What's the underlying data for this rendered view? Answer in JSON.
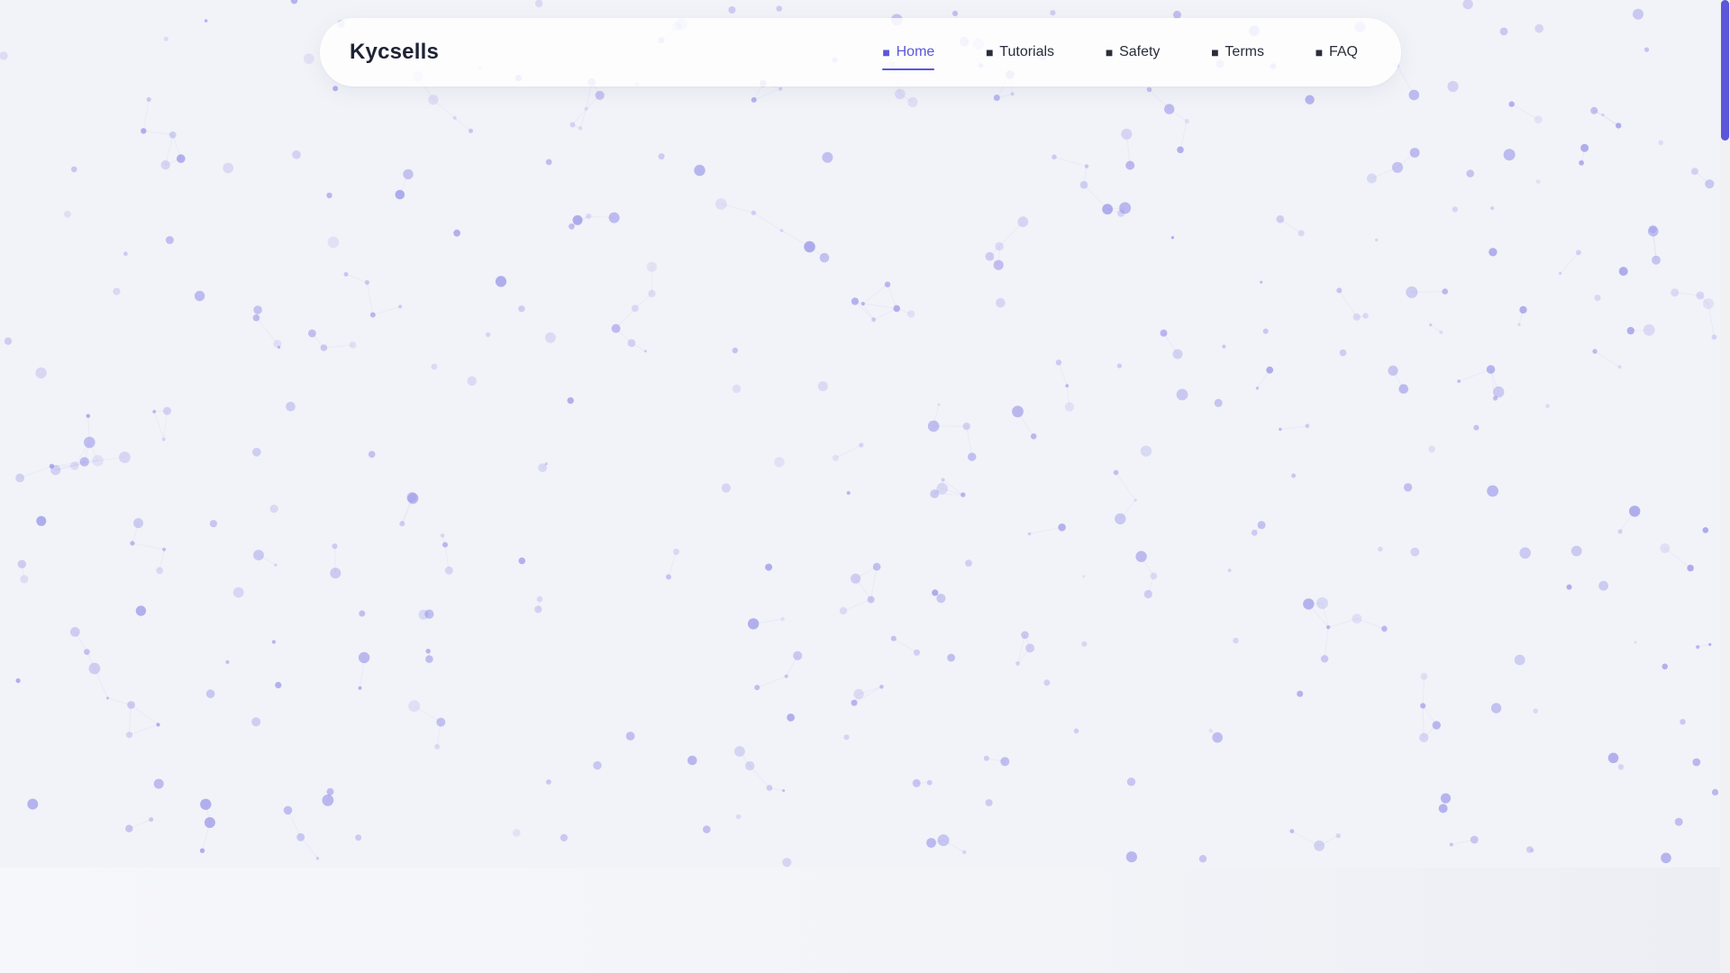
{
  "brand": {
    "name": "Kycsells"
  },
  "nav": {
    "items": [
      {
        "label": "Home",
        "icon": "home-icon",
        "active": true
      },
      {
        "label": "Tutorials",
        "icon": "book-icon",
        "active": false
      },
      {
        "label": "Safety",
        "icon": "shield-icon",
        "active": false
      },
      {
        "label": "Terms",
        "icon": "document-icon",
        "active": false
      },
      {
        "label": "FAQ",
        "icon": "question-icon",
        "active": false
      }
    ]
  },
  "colors": {
    "accent": "#5b57d9",
    "particle": "#8a84e6",
    "background": "#f1f3f8",
    "text": "#1f2233"
  }
}
